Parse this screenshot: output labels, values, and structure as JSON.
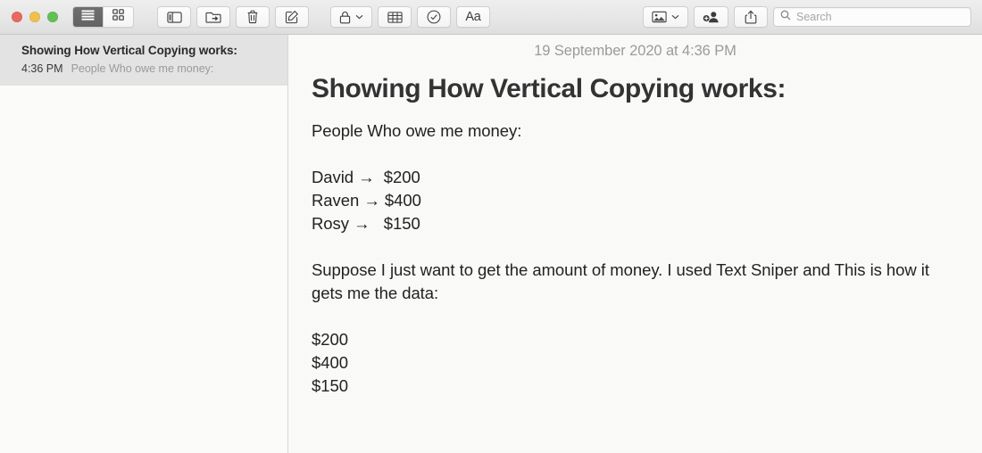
{
  "window": {
    "traffic_lights": [
      {
        "name": "close",
        "color": "#e8695e"
      },
      {
        "name": "minimize",
        "color": "#f0bf4c"
      },
      {
        "name": "zoom",
        "color": "#62c055"
      }
    ]
  },
  "toolbar": {
    "view_segmented": [
      {
        "id": "list-view",
        "label": "List View",
        "selected": true
      },
      {
        "id": "gallery-view",
        "label": "Gallery View",
        "selected": false
      }
    ],
    "buttons": [
      {
        "id": "sidebar-toggle",
        "label": "Show Folders"
      },
      {
        "id": "move-to-folder",
        "label": "Move to Folder"
      },
      {
        "id": "delete-note",
        "label": "Delete Note"
      },
      {
        "id": "compose-note",
        "label": "New Note"
      },
      {
        "id": "lock-note",
        "label": "Lock Note",
        "has_chevron": true
      },
      {
        "id": "table",
        "label": "Table"
      },
      {
        "id": "checklist",
        "label": "Checklist"
      },
      {
        "id": "format",
        "label": "Aa"
      },
      {
        "id": "media",
        "label": "Media",
        "has_chevron": true
      },
      {
        "id": "add-people",
        "label": "Add People"
      },
      {
        "id": "share",
        "label": "Share"
      }
    ],
    "format_label": "Aa"
  },
  "search": {
    "placeholder": "Search",
    "value": ""
  },
  "sidebar": {
    "notes": [
      {
        "title": "Showing How Vertical Copying works:",
        "time": "4:36 PM",
        "preview": "People Who owe me money:",
        "selected": true
      }
    ]
  },
  "note": {
    "date": "19 September 2020 at 4:36 PM",
    "heading": "Showing How Vertical Copying works:",
    "intro": "People Who owe me money:",
    "debts": [
      "David →  $200",
      "Raven → $400",
      "Rosy →   $150"
    ],
    "explanation": "Suppose I just want to get the amount of money. I used Text Sniper and This is how it gets me the data:",
    "amounts": [
      "$200",
      "$400",
      "$150"
    ]
  }
}
